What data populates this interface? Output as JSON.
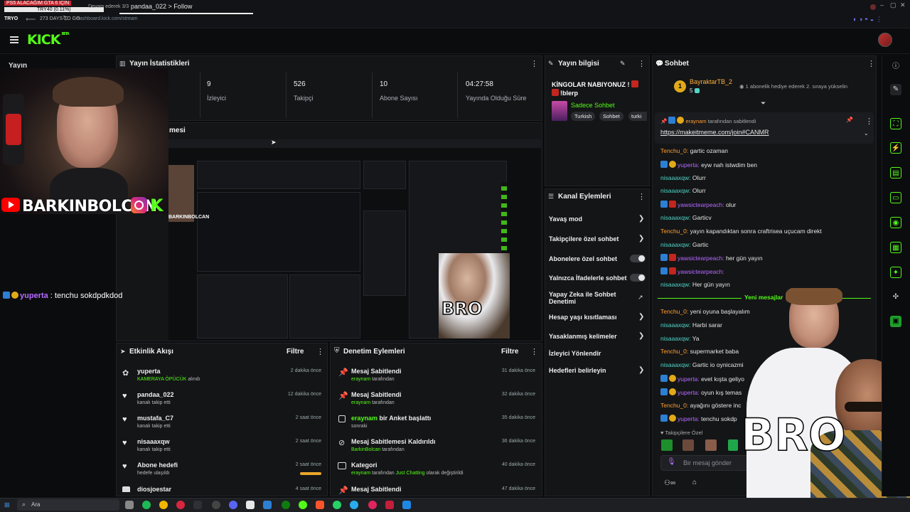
{
  "browser": {
    "ticker_line1": "PS5 ALACAĞIM GTA 6 İÇİN",
    "ticker_line2": "TRY40 (0.11%)",
    "ticker_line3": "273 DAYS TO GO",
    "brand_tag": "TRYO",
    "progress_label": "Devam ederek 3/3",
    "tab_title": "pandaa_022 > Follow",
    "address": "dashboard.kick.com/stream"
  },
  "header": {
    "logo": "KICK",
    "logo_sup": "BETA"
  },
  "sidebar": {
    "heading": "Yayın"
  },
  "webcam": {
    "brand_name": "BARKINBOLCAN",
    "overlay_chat_user": "yuperta",
    "overlay_chat_text": " : tenchu sokdpdkdod"
  },
  "stats": {
    "title": "Yayın İstatistikleri",
    "items": [
      {
        "value": "9",
        "label": "İzleyici"
      },
      {
        "value": "526",
        "label": "Takipçi"
      },
      {
        "value": "10",
        "label": "Abone Sayısı"
      },
      {
        "value": "04:27:58",
        "label": "Yayında Olduğu Süre"
      }
    ]
  },
  "preview": {
    "title_fragment": "mesi",
    "bro_small": "BRO",
    "brand_small": "BARKINBOLCAN"
  },
  "stream_info": {
    "title": "Yayın bilgisi",
    "stream_title_line1": "KİNGOLAR NABIYONUZ !",
    "stream_title_line2": "!blerp",
    "category": "Sadece Sohbet",
    "tags": [
      "Turkish",
      "Sohbet",
      "turki"
    ]
  },
  "channel_actions": {
    "title": "Kanal Eylemleri",
    "items": [
      {
        "label": "Yavaş mod",
        "control": "chevron"
      },
      {
        "label": "Takipçilere özel sohbet",
        "control": "chevron"
      },
      {
        "label": "Abonelere özel sohbet",
        "control": "toggle"
      },
      {
        "label": "Yalnızca İfadelerle sohbet",
        "control": "toggle"
      },
      {
        "label": "Yapay Zeka ile Sohbet Denetimi",
        "control": "external"
      },
      {
        "label": "Hesap yaşı kısıtlaması",
        "control": "chevron"
      },
      {
        "label": "Yasaklanmış kelimeler",
        "control": "chevron"
      },
      {
        "label": "İzleyici Yönlendir",
        "control": "none"
      },
      {
        "label": "Hedefleri belirleyin",
        "control": "chevron"
      }
    ]
  },
  "activity": {
    "title": "Etkinlik Akışı",
    "filter": "Filtre",
    "items": [
      {
        "name": "yuperta",
        "sub_highlight": "KAMERAYA ÖPÜCÜK",
        "sub": " alındı",
        "time": "2 dakika önce",
        "icon": "gift-icon"
      },
      {
        "name": "pandaa_022",
        "sub_highlight": "",
        "sub": "kanalı takip etti",
        "time": "12 dakika önce",
        "icon": "heart-icon"
      },
      {
        "name": "mustafa_C7",
        "sub_highlight": "",
        "sub": "kanalı takip etti",
        "time": "2 saat önce",
        "icon": "heart-icon"
      },
      {
        "name": "nisaaaxqw",
        "sub_highlight": "",
        "sub": "kanalı takip etti",
        "time": "2 saat önce",
        "icon": "heart-icon"
      },
      {
        "name": "Abone hedefi",
        "sub_highlight": "",
        "sub": "hedefe ulaşıldı",
        "time": "2 saat önce",
        "icon": "heart-icon"
      },
      {
        "name": "diosjoestar",
        "sub_highlight": "",
        "sub": "",
        "time": "4 saat önce",
        "icon": "heart-icon"
      }
    ]
  },
  "moderation": {
    "title": "Denetim Eylemleri",
    "filter": "Filtre",
    "items": [
      {
        "title": "Mesaj Sabitlendi",
        "user": "eraynam",
        "rest": " tarafından",
        "time": "31 dakika önce",
        "icon": "pin-icon"
      },
      {
        "title": "Mesaj Sabitlendi",
        "user": "eraynam",
        "rest": " tarafından",
        "time": "32 dakika önce",
        "icon": "pin-icon"
      },
      {
        "title_user": "eraynam",
        "title": " bir Anket başlattı",
        "user": "",
        "rest": "sonraki",
        "time": "35 dakika önce",
        "icon": "poll-icon"
      },
      {
        "title": "Mesaj Sabitlemesi Kaldırıldı",
        "user": "BarkinBolcan",
        "rest": " tarafından",
        "time": "36 dakika önce",
        "icon": "unpin-icon"
      },
      {
        "title": "Kategori",
        "user": "eraynam",
        "rest": " tarafından ",
        "extra": "Just Chatting",
        "rest2": " olarak değiştirildi",
        "time": "40 dakika önce",
        "icon": "category-icon"
      },
      {
        "title": "Mesaj Sabitlendi",
        "user": "",
        "rest": "",
        "time": "47 dakika önce",
        "icon": "pin-icon"
      }
    ]
  },
  "chat": {
    "title": "Sohbet",
    "top_gifter": "BayraktarTB_2",
    "top_gifter_count": "5",
    "gift_message": "1 abonelik hediye ederek 2. sıraya yükselin",
    "pinned_by": "eraynam",
    "pinned_suffix": " tarafından sabitlendi",
    "pinned_link": "https://makeitmeme.com/join#CANMR",
    "new_messages": "Yeni mesajlar",
    "followers_only": "Takipçilere Özel",
    "input_placeholder": "Bir mesaj gönder",
    "bro": "BRO",
    "messages_before": [
      {
        "user": "Tenchu_0",
        "color": "orange",
        "badges": [],
        "text": " gartic ozaman"
      },
      {
        "user": "yuperta",
        "color": "purple",
        "badges": [
          "blue",
          "gold"
        ],
        "text": " eyw nah istwdim ben"
      },
      {
        "user": "nisaaaxqw",
        "color": "cyan",
        "badges": [],
        "text": " Olurr"
      },
      {
        "user": "nisaaaxqw",
        "color": "cyan",
        "badges": [],
        "text": " Olurr"
      },
      {
        "user": "yawsictearpeach",
        "color": "purple",
        "badges": [
          "blue",
          "red"
        ],
        "text": " olur"
      },
      {
        "user": "nisaaaxqw",
        "color": "cyan",
        "badges": [],
        "text": " Garticv"
      },
      {
        "user": "Tenchu_0",
        "color": "orange",
        "badges": [],
        "text": " yayın kapandıktan sonra craftrisea uçucam direkt"
      },
      {
        "user": "nisaaaxqw",
        "color": "cyan",
        "badges": [],
        "text": " Gartic"
      },
      {
        "user": "yawsictearpeach",
        "color": "purple",
        "badges": [
          "blue",
          "red"
        ],
        "text": " her gün yayın"
      },
      {
        "user": "yawsictearpeach",
        "color": "purple",
        "badges": [
          "blue",
          "red"
        ],
        "text": " "
      },
      {
        "user": "nisaaaxqw",
        "color": "cyan",
        "badges": [],
        "text": " Her gün yayın"
      }
    ],
    "messages_after": [
      {
        "user": "Tenchu_0",
        "color": "orange",
        "badges": [],
        "text": " yeni oyuna başlayalım"
      },
      {
        "user": "nisaaaxqw",
        "color": "cyan",
        "badges": [],
        "text": " Harbi sarar"
      },
      {
        "user": "nisaaaxqw",
        "color": "cyan",
        "badges": [],
        "text": " Ya"
      },
      {
        "user": "Tenchu_0",
        "color": "orange",
        "badges": [],
        "text": " supermarket baba"
      },
      {
        "user": "nisaaaxqw",
        "color": "cyan",
        "badges": [],
        "text": " Gartic io oynicazmi"
      },
      {
        "user": "yuperta",
        "color": "purple",
        "badges": [
          "blue",
          "gold"
        ],
        "text": " evet kışta geliyo"
      },
      {
        "user": "yuperta",
        "color": "purple",
        "badges": [
          "blue",
          "gold"
        ],
        "text": " oyun kış temas"
      },
      {
        "user": "Tenchu_0",
        "color": "orange",
        "badges": [],
        "text": " ayağını göstere inc"
      },
      {
        "user": "yuperta",
        "color": "purple",
        "badges": [
          "blue",
          "gold"
        ],
        "text": " tenchu sokdp"
      }
    ]
  },
  "taskbar": {
    "search": "Ara"
  },
  "colors": {
    "accent": "#53fc18",
    "panel": "#141517",
    "background": "#0b0c0e"
  }
}
